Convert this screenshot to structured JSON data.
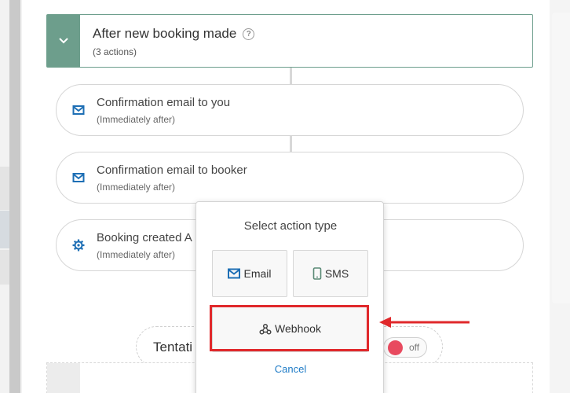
{
  "trigger": {
    "title": "After new booking made",
    "subtitle": "(3 actions)",
    "help_icon": "?"
  },
  "actions": [
    {
      "icon": "mail-icon",
      "label": "Confirmation email to you",
      "when": "(Immediately after)"
    },
    {
      "icon": "mail-icon",
      "label": "Confirmation email to booker",
      "when": "(Immediately after)"
    },
    {
      "icon": "gear-icon",
      "label": "Booking created A",
      "when": "(Immediately after)"
    }
  ],
  "tentative": {
    "label": "Tentati",
    "switch_state": "off"
  },
  "popup": {
    "title": "Select action type",
    "options": [
      {
        "icon": "mail-icon",
        "label": "Email"
      },
      {
        "icon": "phone-icon",
        "label": "SMS"
      },
      {
        "icon": "webhook-icon",
        "label": "Webhook"
      }
    ],
    "cancel": "Cancel"
  },
  "colors": {
    "accent_green": "#6d9e8c",
    "link_blue": "#1e7bc6",
    "highlight_red": "#e0282b",
    "switch_off": "#e84a5f"
  }
}
